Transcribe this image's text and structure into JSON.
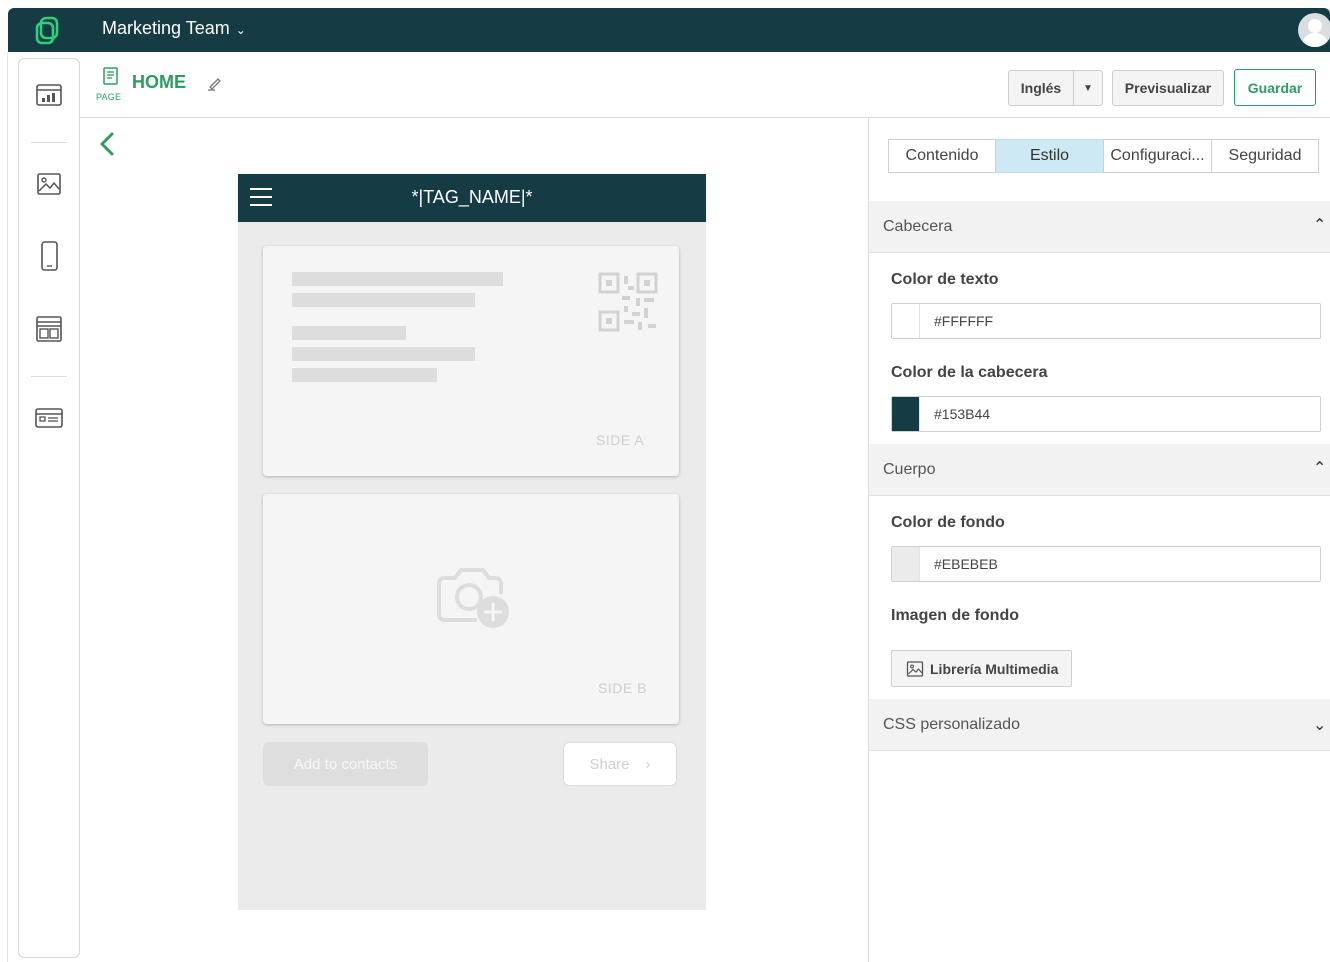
{
  "topbar": {
    "team_name": "Marketing Team",
    "brand_color": "#153b44"
  },
  "sidebar": {
    "items": [
      {
        "icon": "stats-icon"
      },
      {
        "icon": "image-icon"
      },
      {
        "icon": "mobile-icon"
      },
      {
        "icon": "layout-icon"
      },
      {
        "icon": "card-icon"
      }
    ]
  },
  "header": {
    "page_label": "PAGE",
    "title": "HOME",
    "language": "Inglés",
    "preview_label": "Previsualizar",
    "save_label": "Guardar",
    "accent_color": "#2a9d62"
  },
  "preview": {
    "tag_name": "*|TAG_NAME|*",
    "side_a": "SIDE A",
    "side_b": "SIDE B",
    "add_contacts": "Add to contacts",
    "share": "Share"
  },
  "panel": {
    "tabs": [
      {
        "label": "Contenido",
        "active": false
      },
      {
        "label": "Estilo",
        "active": true
      },
      {
        "label": "Configuraci...",
        "active": false
      },
      {
        "label": "Seguridad",
        "active": false
      }
    ],
    "sections": {
      "header": "Cabecera",
      "body": "Cuerpo",
      "css": "CSS personalizado"
    },
    "text_color_label": "Color de texto",
    "text_color_value": "#FFFFFF",
    "header_color_label": "Color de la cabecera",
    "header_color_value": "#153B44",
    "bg_color_label": "Color de fondo",
    "bg_color_value": "#EBEBEB",
    "bg_image_label": "Imagen de fondo",
    "media_button": "Librería Multimedia"
  }
}
